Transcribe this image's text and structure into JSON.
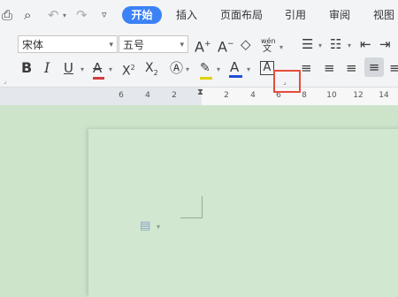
{
  "menu": {
    "tabs": [
      "开始",
      "插入",
      "页面布局",
      "引用",
      "审阅",
      "视图"
    ]
  },
  "toolbar": {
    "font_name": "宋体",
    "font_size": "五号",
    "phonetic_label": "wén",
    "icons": {
      "print": "print-icon",
      "preview": "print-preview-icon",
      "undo": "undo-icon",
      "redo": "redo-icon",
      "more": "more-icon",
      "grow_font": "increase-font-size-icon",
      "shrink_font": "decrease-font-size-icon",
      "clear_format": "clear-formatting-icon",
      "bold": "B",
      "italic": "I",
      "underline": "U",
      "strikethrough": "A",
      "superscript": "X²",
      "subscript": "X₂",
      "text_effect": "A",
      "highlight": "highlighter-icon",
      "font_color": "A",
      "char_border": "A"
    },
    "colors": {
      "font_color": "#1f4fd8",
      "highlight": "#e0d100",
      "strike_underline": "#d23b3b",
      "accent": "#3b82f6"
    }
  },
  "ruler": {
    "numbers": [
      "6",
      "4",
      "2",
      "2",
      "4",
      "6",
      "8",
      "10",
      "12",
      "14"
    ]
  }
}
